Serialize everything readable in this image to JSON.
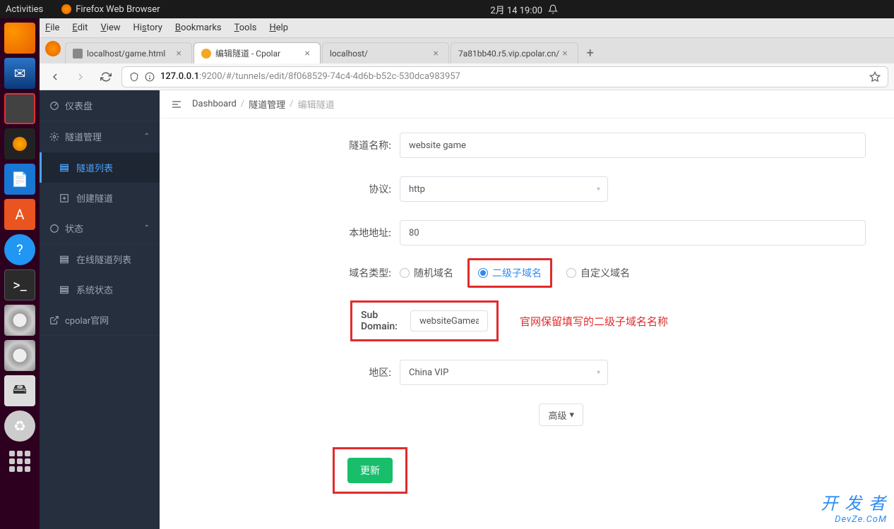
{
  "topbar": {
    "activities": "Activities",
    "browser": "Firefox Web Browser",
    "datetime": "2月 14  19:00"
  },
  "menubar": {
    "file": "File",
    "edit": "Edit",
    "view": "View",
    "history": "History",
    "bookmarks": "Bookmarks",
    "tools": "Tools",
    "help": "Help"
  },
  "tabs": [
    {
      "title": "localhost/game.html",
      "active": false
    },
    {
      "title": "编辑隧道 - Cpolar",
      "active": true
    },
    {
      "title": "localhost/",
      "active": false
    },
    {
      "title": "7a81bb40.r5.vip.cpolar.cn/",
      "active": false
    }
  ],
  "url": {
    "host": "127.0.0.1",
    "port_path": ":9200/#/tunnels/edit/8f068529-74c4-4d6b-b52c-530dca983957"
  },
  "sidebar": {
    "dashboard": "仪表盘",
    "tunnels": "隧道管理",
    "tunnel_list": "隧道列表",
    "tunnel_create": "创建隧道",
    "status": "状态",
    "online_list": "在线隧道列表",
    "system_status": "系统状态",
    "official": "cpolar官网"
  },
  "breadcrumbs": {
    "dashboard": "Dashboard",
    "tunnels": "隧道管理",
    "edit": "编辑隧道"
  },
  "form": {
    "name_label": "隧道名称:",
    "name_value": "website game",
    "protocol_label": "协议:",
    "protocol_value": "http",
    "local_addr_label": "本地地址:",
    "local_addr_value": "80",
    "domain_type_label": "域名类型:",
    "domain_type_random": "随机域名",
    "domain_type_sub": "二级子域名",
    "domain_type_custom": "自定义域名",
    "subdomain_label": "Sub Domain:",
    "subdomain_value": "websiteGamea",
    "annotation": "官网保留填写的二级子域名名称",
    "region_label": "地区:",
    "region_value": "China VIP",
    "advanced": "高级",
    "submit": "更新"
  },
  "watermark": {
    "top": "开 发 者",
    "bottom": "DevZe.CoM"
  }
}
